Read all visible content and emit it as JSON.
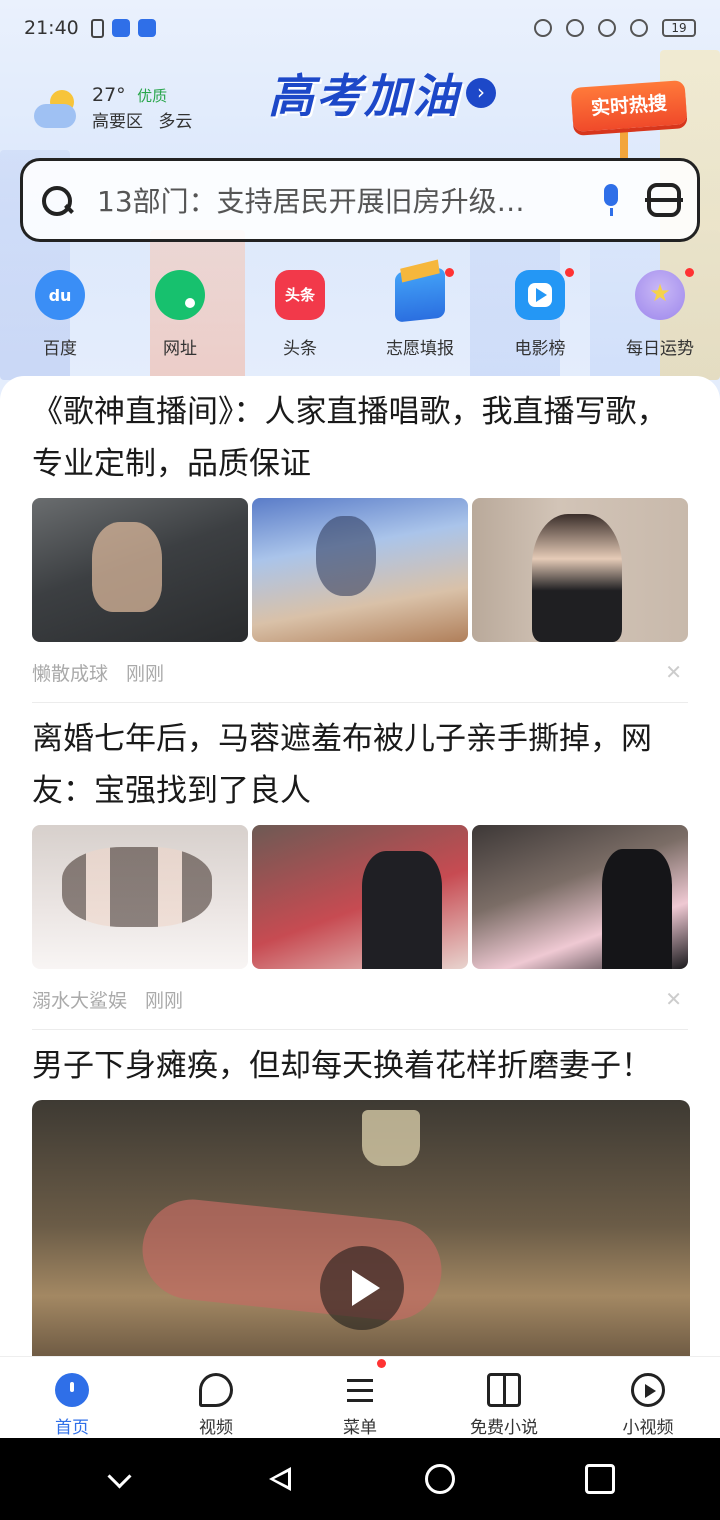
{
  "status_bar": {
    "time": "21:40",
    "battery": "19"
  },
  "weather": {
    "temperature": "27°",
    "air_quality": "优质",
    "location": "高要区",
    "condition": "多云"
  },
  "header": {
    "logo_text": "高考加油",
    "hot_search_label": "实时热搜"
  },
  "search": {
    "query": "13部门：支持居民开展旧房升级…"
  },
  "shortcuts": [
    {
      "label": "百度",
      "icon": "baidu-icon",
      "badge": false
    },
    {
      "label": "网址",
      "icon": "url-icon",
      "badge": false
    },
    {
      "label": "头条",
      "icon": "toutiao-icon",
      "icon_text": "头条",
      "badge": false
    },
    {
      "label": "志愿填报",
      "icon": "graduation-cap-icon",
      "badge": true
    },
    {
      "label": "电影榜",
      "icon": "movie-icon",
      "badge": true
    },
    {
      "label": "每日运势",
      "icon": "fortune-icon",
      "badge": true
    }
  ],
  "feed": {
    "articles": [
      {
        "title": "《歌神直播间》：人家直播唱歌，我直播写歌，专业定制，品质保证",
        "source": "懒散成球",
        "time": "刚刚"
      },
      {
        "title": "离婚七年后，马蓉遮羞布被儿子亲手撕掉，网友：宝强找到了良人",
        "source": "溺水大鲨娱",
        "time": "刚刚"
      },
      {
        "title": "男子下身瘫痪，但却每天换着花样折磨妻子！"
      }
    ]
  },
  "tabbar": [
    {
      "label": "首页",
      "icon": "home-icon",
      "active": true
    },
    {
      "label": "视频",
      "icon": "video-icon",
      "active": false
    },
    {
      "label": "菜单",
      "icon": "menu-icon",
      "active": false,
      "badge": true
    },
    {
      "label": "免费小说",
      "icon": "book-icon",
      "active": false
    },
    {
      "label": "小视频",
      "icon": "short-video-icon",
      "active": false
    }
  ],
  "colors": {
    "accent": "#2f6fe8",
    "badge_red": "#ff3333",
    "air_quality_green": "#29a64b"
  }
}
